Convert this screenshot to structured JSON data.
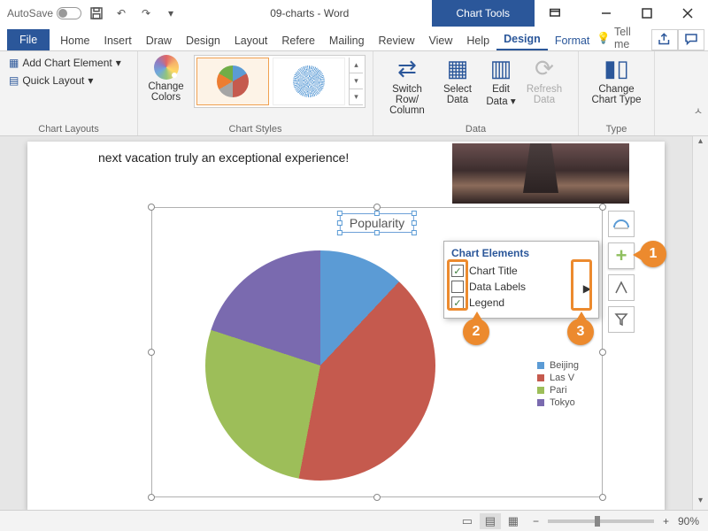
{
  "titlebar": {
    "autosave_label": "AutoSave",
    "autosave_state": "Off",
    "doc_title": "09-charts - Word",
    "chart_tools": "Chart Tools"
  },
  "tabs": {
    "file": "File",
    "list": [
      "Home",
      "Insert",
      "Draw",
      "Design",
      "Layout",
      "Refere",
      "Mailing",
      "Review",
      "View",
      "Help"
    ],
    "ctx": [
      "Design",
      "Format"
    ],
    "active_ctx": "Design",
    "tell_me": "Tell me"
  },
  "ribbon": {
    "add_chart_element": "Add Chart Element",
    "quick_layout": "Quick Layout",
    "change_colors": "Change Colors",
    "switch_row_col": "Switch Row/\nColumn",
    "select_data": "Select Data",
    "edit_data": "Edit Data",
    "refresh_data": "Refresh Data",
    "change_chart_type": "Change Chart Type",
    "grp_layouts": "Chart Layouts",
    "grp_styles": "Chart Styles",
    "grp_data": "Data",
    "grp_type": "Type"
  },
  "document": {
    "line": "next vacation truly an exceptional experience!"
  },
  "chart_ui": {
    "title": "Popularity",
    "flyout_header": "Chart Elements",
    "opt_title": "Chart Title",
    "opt_labels": "Data Labels",
    "opt_legend": "Legend",
    "legend_items": [
      "Beijing",
      "Las V",
      "Pari",
      "Tokyo"
    ]
  },
  "callouts": {
    "c1": "1",
    "c2": "2",
    "c3": "3"
  },
  "status": {
    "zoom": "90%",
    "minus": "−",
    "plus": "+"
  },
  "chart_data": {
    "type": "pie",
    "title": "Popularity",
    "categories": [
      "Beijing",
      "Las Vegas",
      "Paris",
      "Tokyo"
    ],
    "values": [
      12,
      41,
      27,
      20
    ],
    "colors": [
      "#5b9bd5",
      "#c55a4e",
      "#9dbe59",
      "#7a6aaf"
    ],
    "legend_position": "right"
  }
}
